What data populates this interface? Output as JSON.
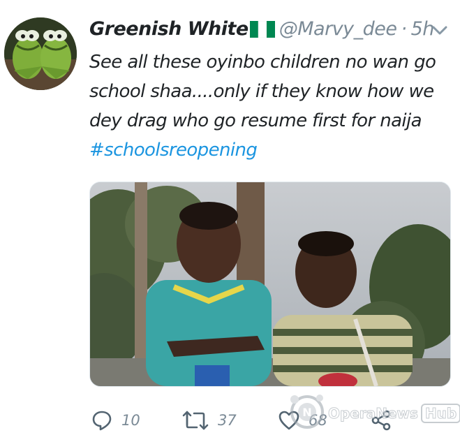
{
  "tweet": {
    "display_name": "Greenish White",
    "handle": "@Marvy_dee",
    "separator": "·",
    "time": "5h",
    "text_lines": [
      "See all these oyinbo children no wan go",
      "school shaa....only if they know how we",
      "dey drag who go resume first for naija"
    ],
    "hashtag": "#schoolsreopening"
  },
  "actions": {
    "reply_count": "10",
    "retweet_count": "37",
    "like_count": "68"
  },
  "watermark": {
    "brand": "OperaNews",
    "suffix": "Hub"
  },
  "colors": {
    "text": "#1f2326",
    "secondary": "#7b8a96",
    "link": "#1b95e0",
    "flag_green": "#008751"
  },
  "icons": {
    "reply": "reply-icon",
    "retweet": "retweet-icon",
    "like": "heart-icon",
    "share": "share-icon",
    "menu": "chevron-down-icon",
    "flag": "nigeria-flag-icon"
  }
}
